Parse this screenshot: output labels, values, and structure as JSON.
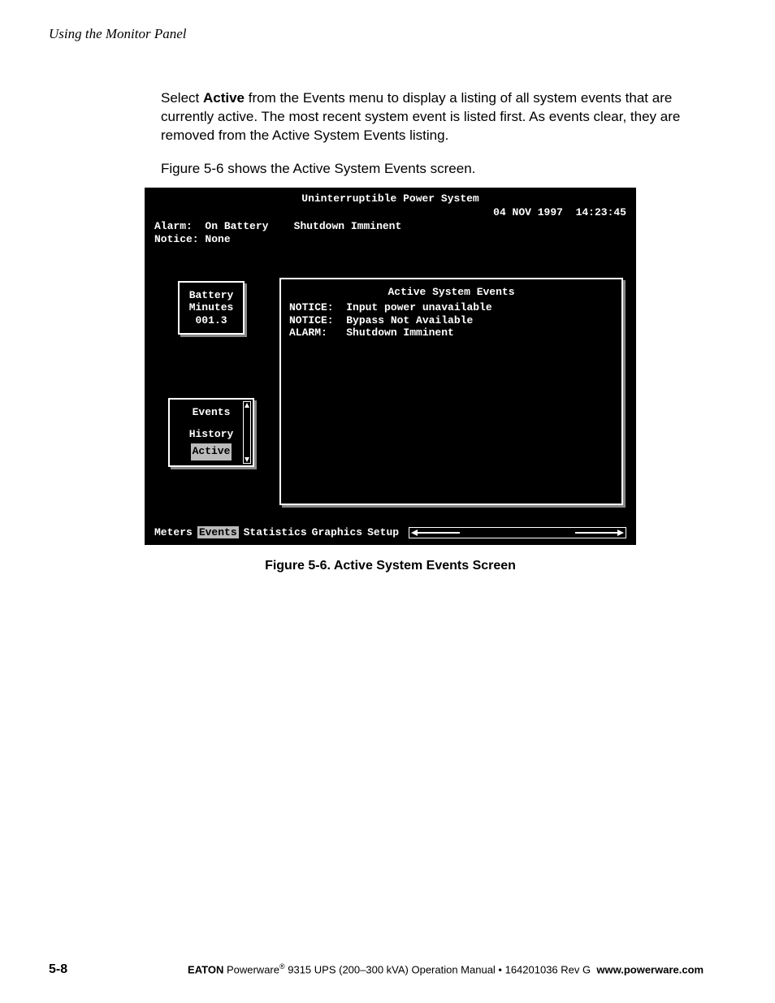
{
  "header": "Using the Monitor Panel",
  "body": {
    "p1_pre": "Select ",
    "p1_bold": "Active",
    "p1_post": " from the Events menu to display a listing of all system events that are currently active. The most recent system event is listed first. As events clear, they are removed from the Active System Events listing.",
    "p2": "Figure 5-6 shows the Active System Events screen."
  },
  "screen": {
    "title": "Uninterruptible Power System",
    "date": "04 NOV 1997",
    "time": "14:23:45",
    "status": {
      "alarm_label": "Alarm:",
      "alarm1": "On Battery",
      "alarm2": "Shutdown Imminent",
      "notice_label": "Notice:",
      "notice_value": "None"
    },
    "battery": {
      "l1": "Battery",
      "l2": "Minutes",
      "l3": "001.3"
    },
    "submenu": {
      "title": "Events",
      "items": [
        "History",
        "Active"
      ],
      "selected_index": 1
    },
    "events_panel": {
      "title": "Active System Events",
      "rows": [
        {
          "tag": "NOTICE:",
          "msg": "Input power unavailable"
        },
        {
          "tag": "NOTICE:",
          "msg": "Bypass Not Available"
        },
        {
          "tag": "ALARM:",
          "msg": "Shutdown Imminent"
        }
      ]
    },
    "menubar": [
      "Meters",
      "Events",
      "Statistics",
      "Graphics",
      "Setup"
    ],
    "menubar_selected_index": 1
  },
  "caption": "Figure 5-6. Active System Events Screen",
  "footer": {
    "page": "5-8",
    "brand": "EATON",
    "prod_pre": " Powerware",
    "reg": "®",
    "prod_post": " 9315 UPS (200–300 kVA) Operation Manual  •  164201036 Rev G",
    "url": "www.powerware.com"
  }
}
